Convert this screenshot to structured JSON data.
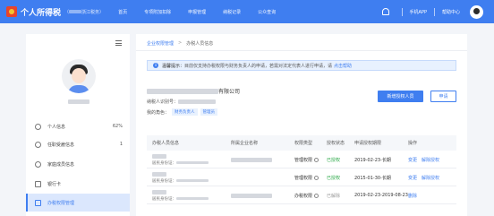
{
  "header": {
    "app_title": "个人所得税",
    "region": "浙江税务",
    "nav": [
      "首页",
      "专项附加扣除",
      "申报管理",
      "纳税记录",
      "公众查询"
    ],
    "right_links": [
      "手机APP",
      "帮助中心"
    ]
  },
  "sidebar": {
    "items": [
      {
        "label": "个人信息",
        "count": "62%",
        "icon": "user-icon"
      },
      {
        "label": "任职受雇信息",
        "count": "1",
        "icon": "user-icon"
      },
      {
        "label": "家庭成员信息",
        "count": "",
        "icon": "family-icon"
      },
      {
        "label": "银行卡",
        "count": "",
        "icon": "card-icon"
      },
      {
        "label": "办税权限管理",
        "count": "",
        "icon": "lock-icon"
      }
    ]
  },
  "main": {
    "breadcrumb": {
      "link": "企业权限管理",
      "sep": ">",
      "current": "办税人员信息"
    },
    "notice": {
      "label": "温馨提示：",
      "text": "目前仅支持办税权限与财务负责人的申请，若需对法定代表人进行申请，请",
      "link": "点击帮助"
    },
    "company": {
      "suffix": "有限公司",
      "tax_id_label": "纳税人识别号：",
      "roles_label": "我的角色：",
      "roles": [
        "财务负责人",
        "管理员"
      ]
    },
    "buttons": {
      "add": "新增授权人员",
      "apply": "申请"
    },
    "table": {
      "headers": [
        "办税人员信息",
        "所属企业名称",
        "权限类型",
        "授权状态",
        "申请授权期限",
        "操作"
      ],
      "rows": [
        {
          "id_label": "居民身份证：",
          "perm": "管理权限",
          "status": "已授权",
          "period": "2019-02-23-长期",
          "actions": [
            "变更",
            "解除授权"
          ]
        },
        {
          "id_label": "居民身份证：",
          "perm": "管理权限",
          "status": "已授权",
          "period": "2015-01-30-长期",
          "actions": [
            "变更",
            "解除授权"
          ]
        },
        {
          "id_label": "居民身份证：",
          "perm": "办税权限",
          "status": "已解除",
          "period": "2019-02-23-2019-08-23",
          "actions": [
            "删除"
          ]
        }
      ]
    }
  },
  "colors": {
    "primary": "#3f7ef0",
    "success": "#28a745",
    "active_bg": "#dbe7fd"
  }
}
